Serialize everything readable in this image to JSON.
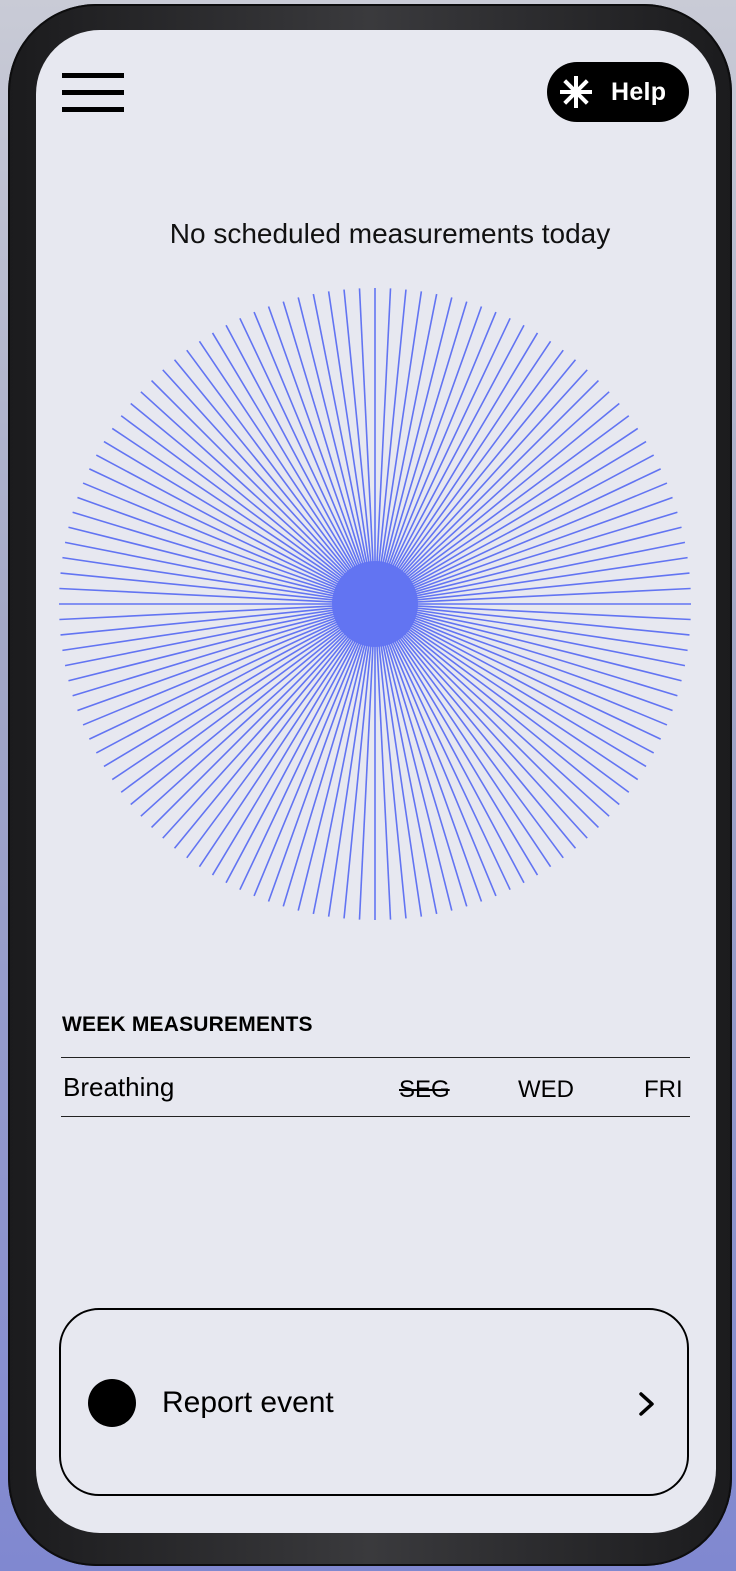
{
  "header": {
    "menu_icon": "hamburger-menu-icon",
    "help": {
      "icon": "asterisk-icon",
      "label": "Help"
    }
  },
  "status": {
    "text": "No scheduled measurements today"
  },
  "visual": {
    "color": "#6274f2",
    "ray_count": 128
  },
  "week": {
    "title": "WEEK MEASUREMENTS",
    "rows": [
      {
        "name": "Breathing",
        "days": [
          {
            "label": "SEG",
            "done": true
          },
          {
            "label": "WED",
            "done": false
          },
          {
            "label": "FRI",
            "done": false
          }
        ]
      }
    ]
  },
  "report": {
    "label": "Report event",
    "icon": "chevron-right-icon"
  },
  "colors": {
    "background": "#e7e8f0",
    "accent": "#6274f2",
    "text": "#000000"
  }
}
